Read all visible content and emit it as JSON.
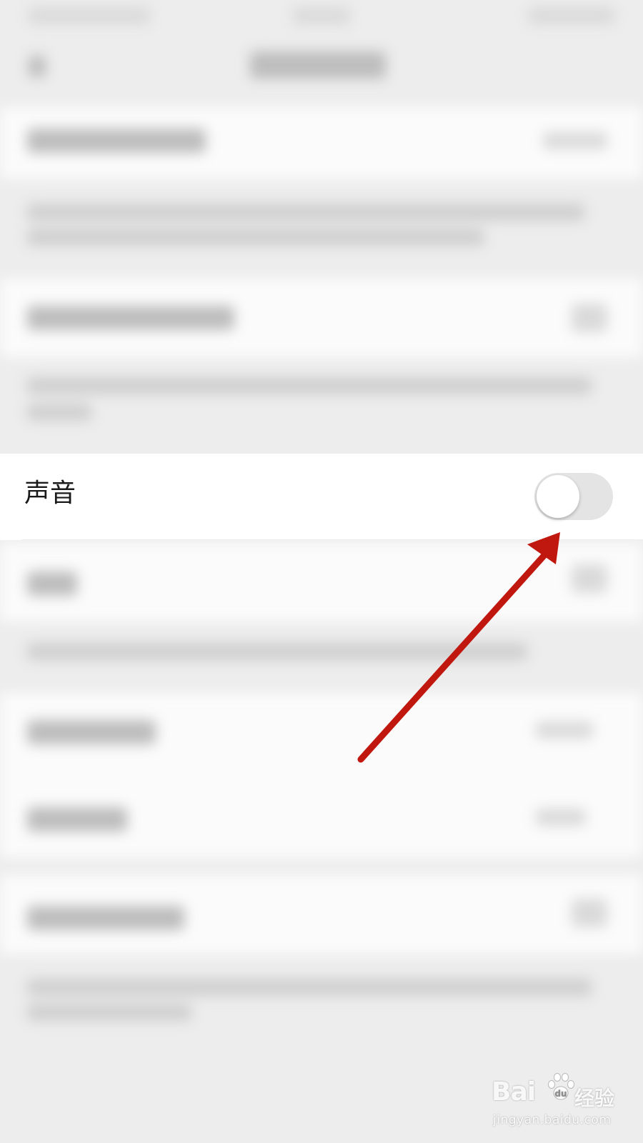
{
  "settings": {
    "sound_row": {
      "label": "声音",
      "toggle_on": false
    }
  },
  "colors": {
    "background": "#ededed",
    "row_background": "#ffffff",
    "toggle_track_off": "#e4e4e4",
    "annotation_arrow": "#c0170e"
  },
  "annotation": {
    "type": "arrow",
    "target": "sound-toggle",
    "color": "#c0170e"
  },
  "watermark": {
    "brand": "Bai",
    "brand_suffix": "经验",
    "url": "jingyan.baidu.com"
  }
}
